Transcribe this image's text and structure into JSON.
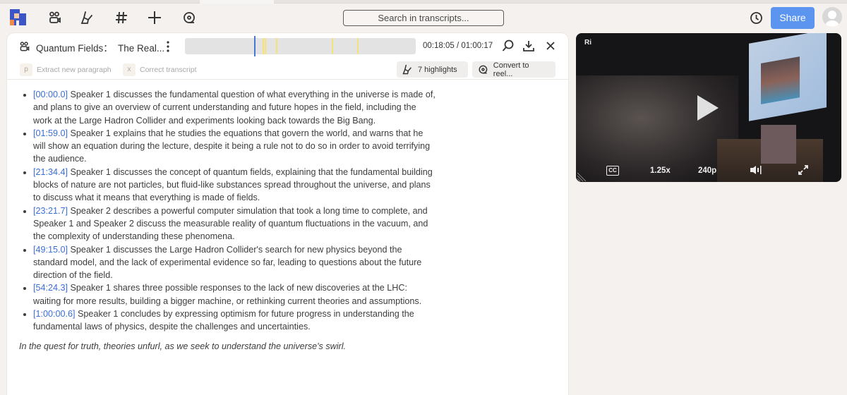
{
  "topbar": {
    "search_placeholder": "Search in transcripts...",
    "share_label": "Share",
    "nav_icons": [
      "logo-icon",
      "recordings-icon",
      "highlight-icon",
      "tags-icon",
      "add-icon",
      "reel-icon"
    ],
    "accent_color": "#5b95f0"
  },
  "transcript": {
    "title": "Quantum Fields：  The Real...",
    "timecode": "00:18:05 / 01:00:17",
    "playhead_fraction": 0.3,
    "highlight_marks_fraction": [
      0.335,
      0.345,
      0.395,
      0.635,
      0.745
    ],
    "actions": [
      {
        "key": "p",
        "label": "Extract new paragraph"
      },
      {
        "key": "x",
        "label": "Correct transcript"
      }
    ],
    "highlights_button": "7 highlights",
    "convert_button": "Convert to reel..."
  },
  "summary": [
    {
      "timestamp": "[00:00.0]",
      "text": " Speaker 1 discusses the fundamental question of what everything in the universe is made of, and plans to give an overview of current understanding and future hopes in the field, including the work at the Large Hadron Collider and experiments looking back towards the Big Bang."
    },
    {
      "timestamp": "[01:59.0]",
      "text": " Speaker 1 explains that he studies the equations that govern the world, and warns that he will show an equation during the lecture, despite it being a rule not to do so in order to avoid terrifying the audience."
    },
    {
      "timestamp": "[21:34.4]",
      "text": " Speaker 1 discusses the concept of quantum fields, explaining that the fundamental building blocks of nature are not particles, but fluid-like substances spread throughout the universe, and plans to discuss what it means that everything is made of fields."
    },
    {
      "timestamp": "[23:21.7]",
      "text": " Speaker 2 describes a powerful computer simulation that took a long time to complete, and Speaker 1 and Speaker 2 discuss the measurable reality of quantum fluctuations in the vacuum, and the complexity of understanding these phenomena."
    },
    {
      "timestamp": "[49:15.0]",
      "text": " Speaker 1 discusses the Large Hadron Collider's search for new physics beyond the standard model, and the lack of experimental evidence so far, leading to questions about the future direction of the field."
    },
    {
      "timestamp": "[54:24.3]",
      "text": " Speaker 1 shares three possible responses to the lack of new discoveries at the LHC: waiting for more results, building a bigger machine, or rethinking current theories and assumptions."
    },
    {
      "timestamp": "[1:00:00.6]",
      "text": " Speaker 1 concludes by expressing optimism for future progress in understanding the fundamental laws of physics, despite the challenges and uncertainties."
    }
  ],
  "poem": "In the quest for truth, theories unfurl, as we seek to understand the universe's swirl.",
  "video": {
    "channel_badge": "Ri",
    "cc_label": "CC",
    "speed": "1.25x",
    "quality": "240p"
  }
}
